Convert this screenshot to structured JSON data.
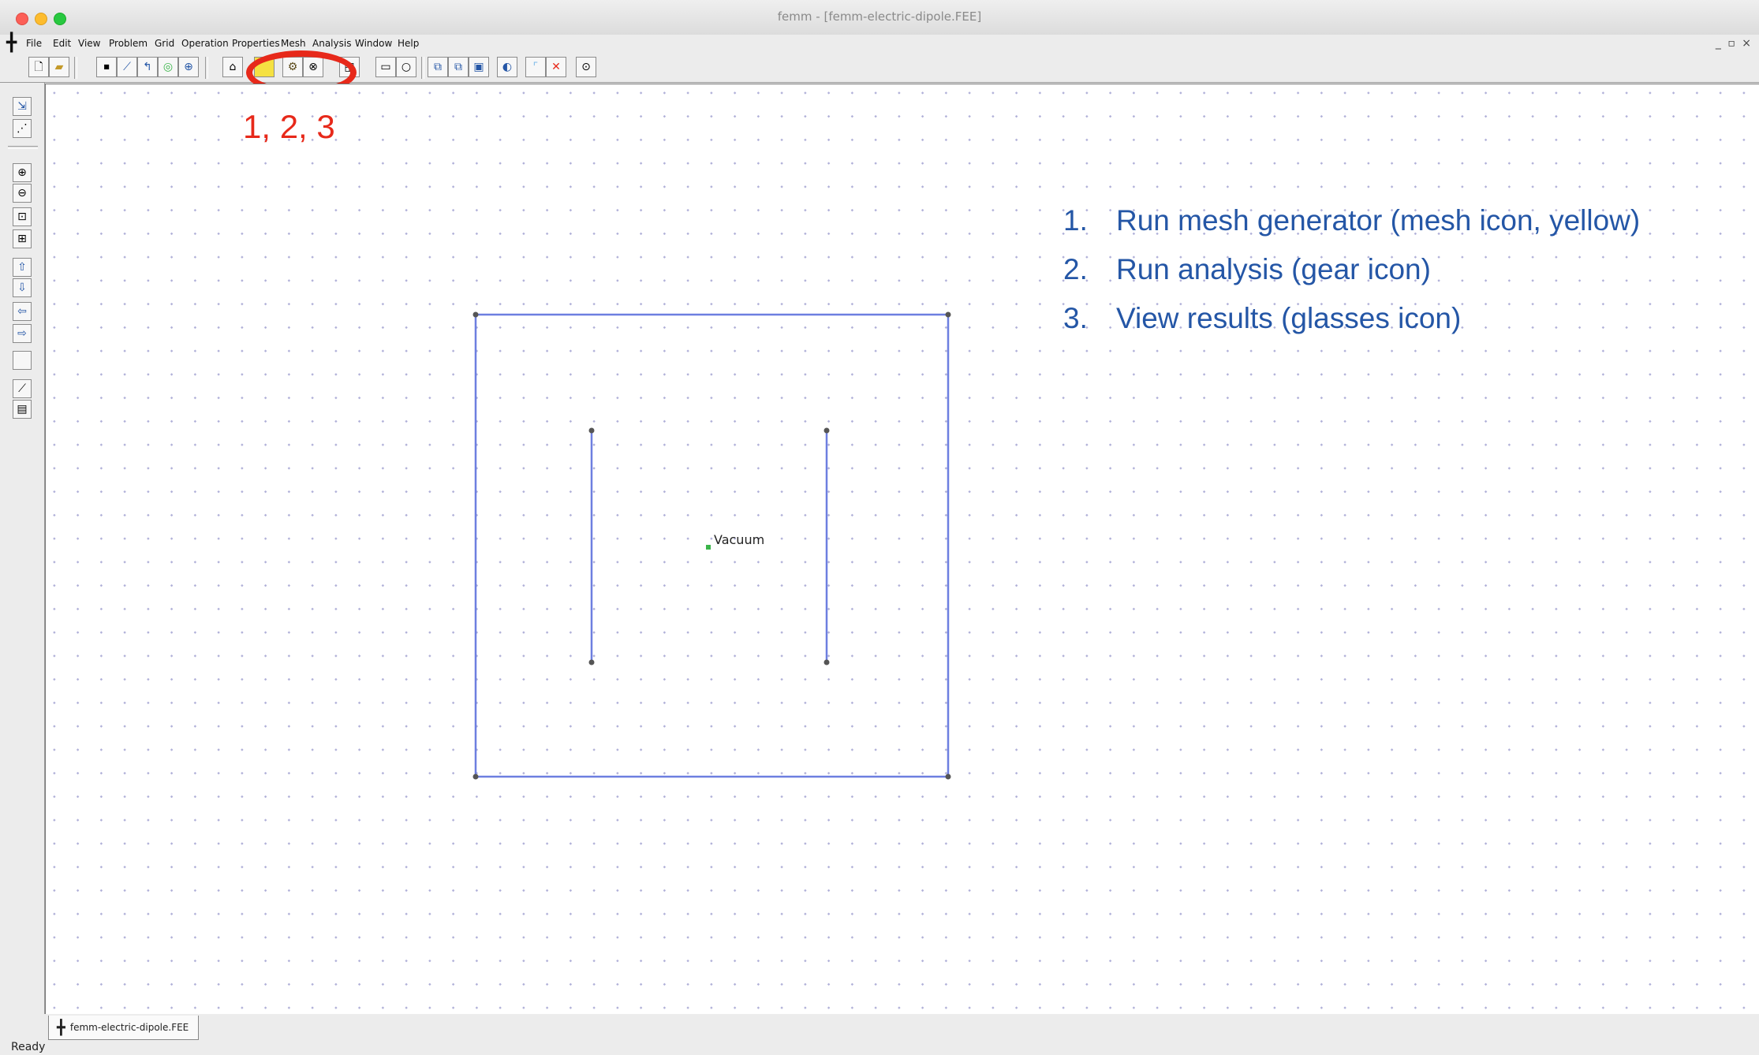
{
  "window": {
    "title": "femm - [femm-electric-dipole.FEE]",
    "controls": "_ ▫ ×",
    "app_glyph": "╋"
  },
  "menu": [
    "File",
    "Edit",
    "View",
    "Problem",
    "Grid",
    "Operation",
    "Properties",
    "Mesh",
    "Analysis",
    "Window",
    "Help"
  ],
  "annotation": {
    "circle_label": "1, 2, 3",
    "steps": [
      {
        "num": "1.",
        "text": "Run mesh generator (mesh icon, yellow)"
      },
      {
        "num": "2.",
        "text": "Run analysis (gear icon)"
      },
      {
        "num": "3.",
        "text": "View results (glasses icon)"
      }
    ],
    "circle_color": "#e7291a",
    "steps_color": "#2456a6"
  },
  "geometry": {
    "region_label": "Vacuum",
    "line_color": "#6d7fe0"
  },
  "document_tab": "femm-electric-dipole.FEE",
  "status": "Ready"
}
